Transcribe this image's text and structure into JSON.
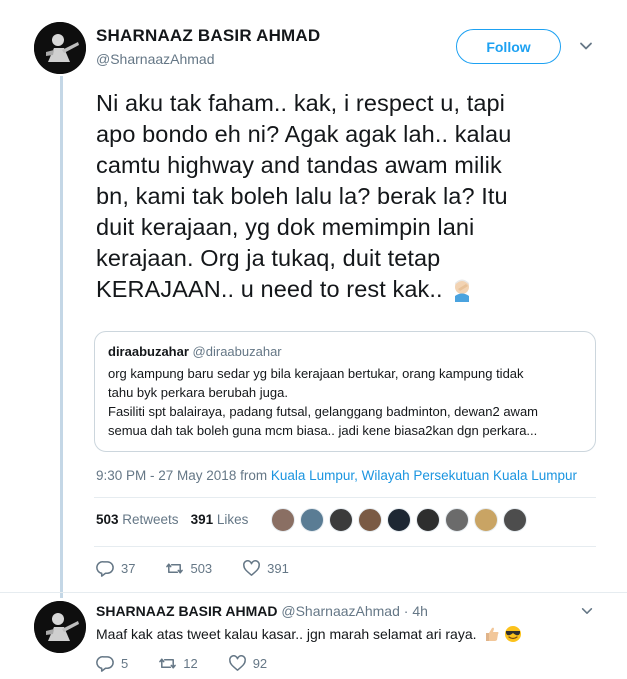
{
  "tweet": {
    "author_name": "SHARNAAZ BASIR AHMAD",
    "author_handle": "@SharnaazAhmad",
    "follow_label": "Follow",
    "text_lines": [
      "Ni aku tak faham.. kak, i respect u, tapi",
      "apo bondo eh ni? Agak agak lah.. kalau",
      "camtu highway and tandas awam milik",
      "bn, kami tak boleh lalu la? berak la? Itu",
      "duit kerajaan, yg dok memimpin lani",
      "kerajaan. Org ja tukaq, duit tetap",
      "KERAJAAN.. u need to rest kak.."
    ],
    "emoji": "face-palm-emoji"
  },
  "quoted": {
    "name": "diraabuzahar",
    "handle": "@diraabuzahar",
    "lines": [
      "org kampung baru sedar yg bila kerajaan bertukar, orang kampung tidak",
      "tahu byk perkara berubah juga.",
      "Fasiliti spt  balairaya, padang futsal, gelanggang badminton, dewan2 awam",
      "semua dah tak boleh guna mcm biasa.. jadi kene biasa2kan dgn perkara..."
    ]
  },
  "meta": {
    "time": "9:30 PM - 27 May 2018 from ",
    "location": "Kuala Lumpur, Wilayah Persekutuan Kuala Lumpur"
  },
  "stats": {
    "retweets_count": "503",
    "retweets_label": " Retweets",
    "likes_count": "391",
    "likes_label": " Likes",
    "liker_colors": [
      "#8a6f63",
      "#5a7c94",
      "#3b3b3b",
      "#7a5a44",
      "#1d2733",
      "#2e2e2e",
      "#6b6b6b",
      "#c9a464",
      "#4d4d4d"
    ]
  },
  "actions": {
    "replies": "37",
    "retweets": "503",
    "likes": "391"
  },
  "reply": {
    "name": "SHARNAAZ BASIR AHMAD",
    "handle": "@SharnaazAhmad",
    "age": " · 4h",
    "text": "Maaf kak atas tweet kalau kasar.. jgn marah selamat ari raya.",
    "emojis": [
      "thumbs-up-emoji",
      "sunglasses-emoji"
    ],
    "replies": "5",
    "retweets": "12",
    "likes": "92"
  },
  "colors": {
    "accent": "#1da1f2",
    "link": "#1b95e0",
    "muted": "#657786",
    "thread_line": "#c4d7e6"
  }
}
